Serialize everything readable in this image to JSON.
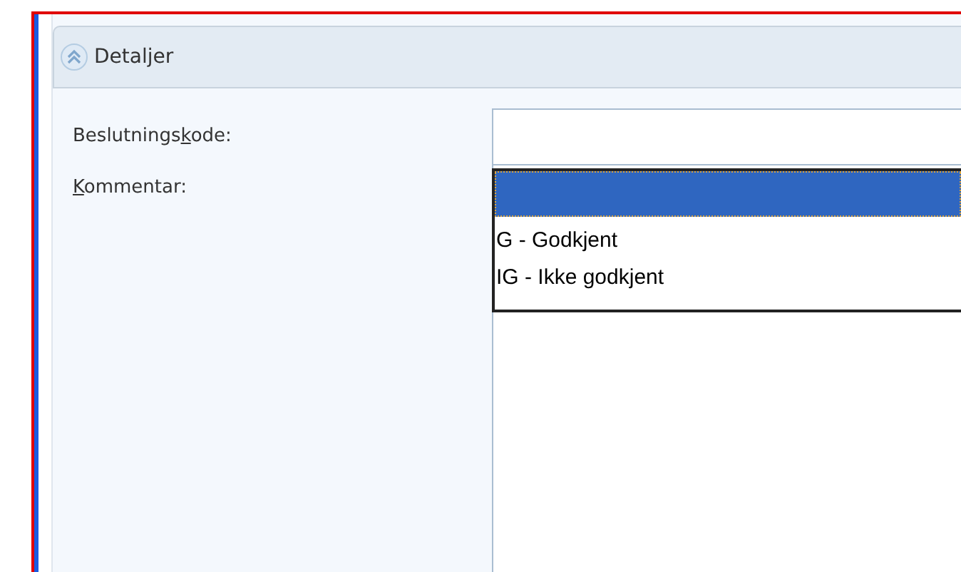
{
  "panel": {
    "title": "Detaljer",
    "expanded": true
  },
  "fields": [
    {
      "kind": "combo",
      "label": {
        "before": "Beslutnings",
        "key": "k",
        "after": "ode:"
      }
    },
    {
      "kind": "memo",
      "label": {
        "key": "K",
        "after": "ommentar:"
      }
    }
  ],
  "dropdown": {
    "options": [
      {
        "selected": true
      },
      {
        "label": "G - Godkjent",
        "selected": false
      },
      {
        "label": "IG - Ikke godkjent",
        "selected": false
      }
    ]
  }
}
